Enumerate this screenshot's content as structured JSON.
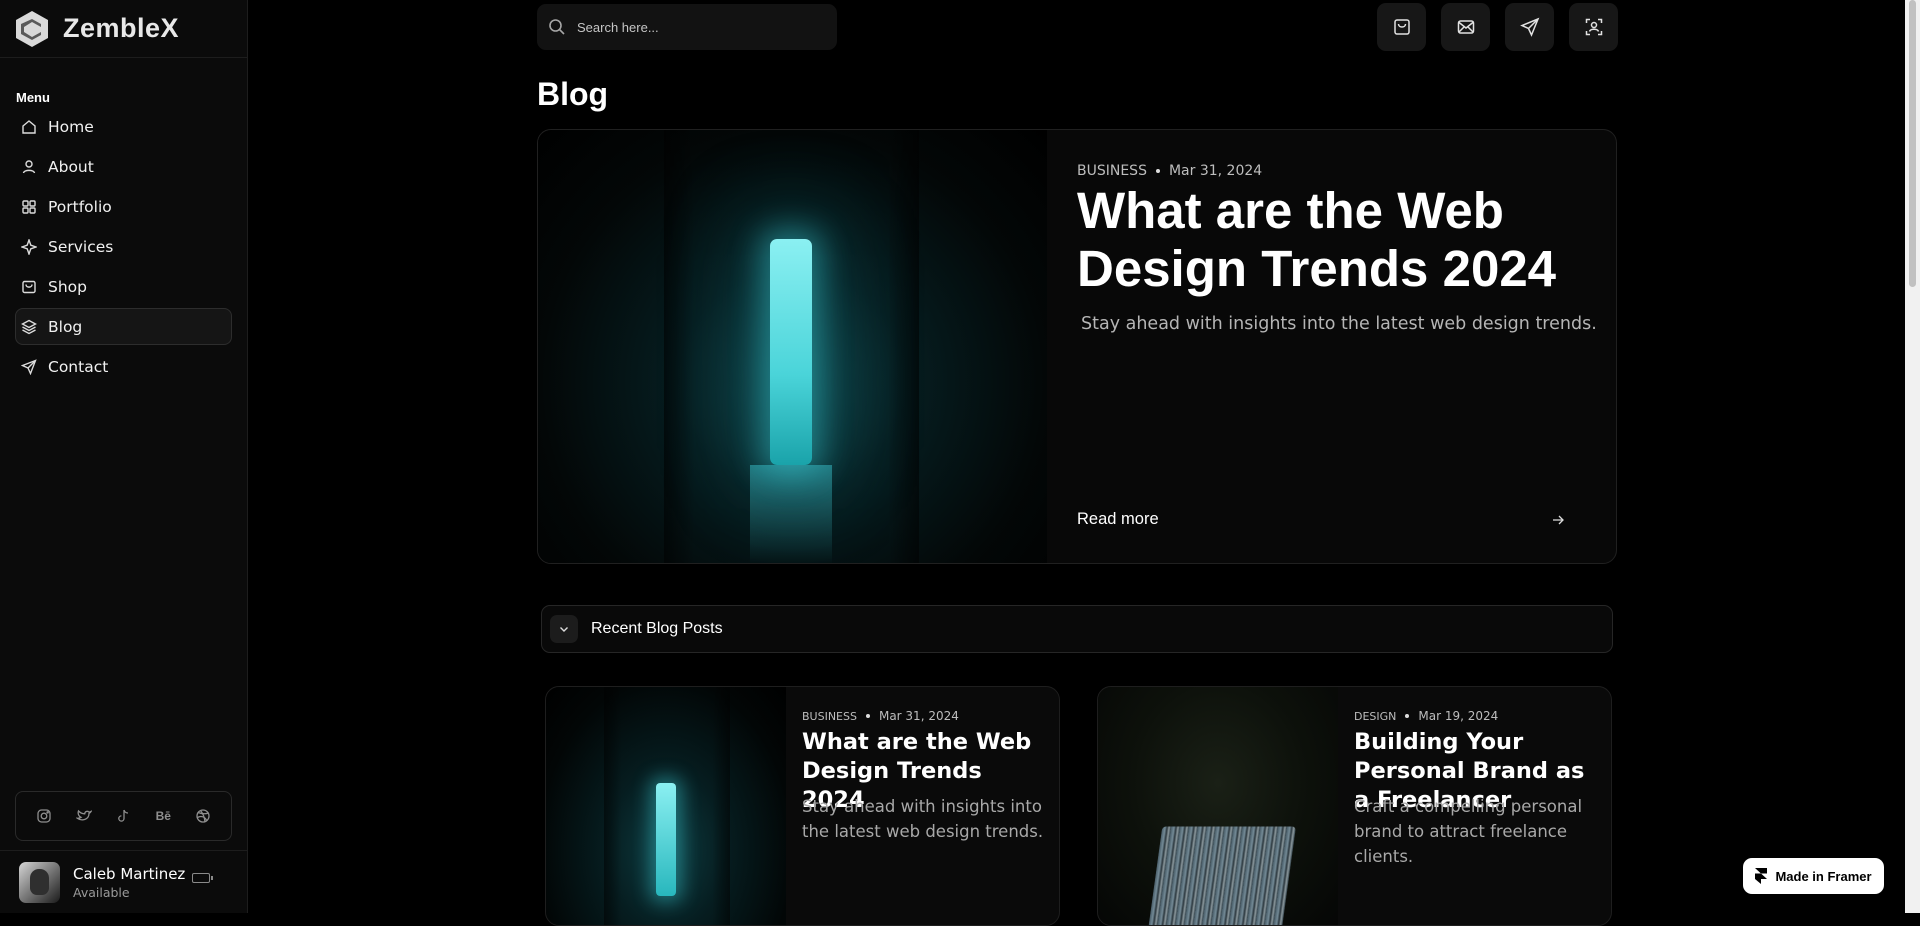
{
  "brand": {
    "name": "ZembleX"
  },
  "sidebar": {
    "menu_title": "Menu",
    "items": [
      {
        "label": "Home",
        "icon": "home-icon"
      },
      {
        "label": "About",
        "icon": "user-icon"
      },
      {
        "label": "Portfolio",
        "icon": "grid-icon"
      },
      {
        "label": "Services",
        "icon": "sparkle-icon"
      },
      {
        "label": "Shop",
        "icon": "shop-icon"
      },
      {
        "label": "Blog",
        "icon": "layers-icon",
        "active": true
      },
      {
        "label": "Contact",
        "icon": "send-icon"
      }
    ],
    "socials": [
      {
        "icon": "instagram-icon"
      },
      {
        "icon": "twitter-icon"
      },
      {
        "icon": "tiktok-icon"
      },
      {
        "icon": "behance-icon",
        "text": "Bē"
      },
      {
        "icon": "dribbble-icon"
      }
    ],
    "profile": {
      "name": "Caleb Martinez",
      "status": "Available"
    }
  },
  "topbar": {
    "search_placeholder": "Search here...",
    "icons": [
      "inbox-icon",
      "mail-icon",
      "send-icon",
      "scan-user-icon"
    ]
  },
  "page": {
    "title": "Blog"
  },
  "featured": {
    "category": "BUSINESS",
    "date": "Mar 31, 2024",
    "title": "What are the Web Design Trends 2024",
    "description": "Stay ahead with insights into the latest web design trends.",
    "read_more": "Read more"
  },
  "recent": {
    "label": "Recent Blog Posts"
  },
  "posts": [
    {
      "category": "BUSINESS",
      "date": "Mar 31, 2024",
      "title": "What are the Web Design Trends 2024",
      "description": "Stay ahead with insights into the latest web design trends."
    },
    {
      "category": "DESIGN",
      "date": "Mar 19, 2024",
      "title": "Building Your Personal Brand as a Freelancer",
      "description": "Craft a compelling personal brand to attract freelance clients."
    }
  ],
  "badge": {
    "label": "Made in Framer"
  },
  "colors": {
    "background": "#000000",
    "sidebar": "#0b0b0b",
    "accent_glow": "#4ad4d9",
    "text": "#ffffff",
    "muted": "#b5b5b5"
  }
}
